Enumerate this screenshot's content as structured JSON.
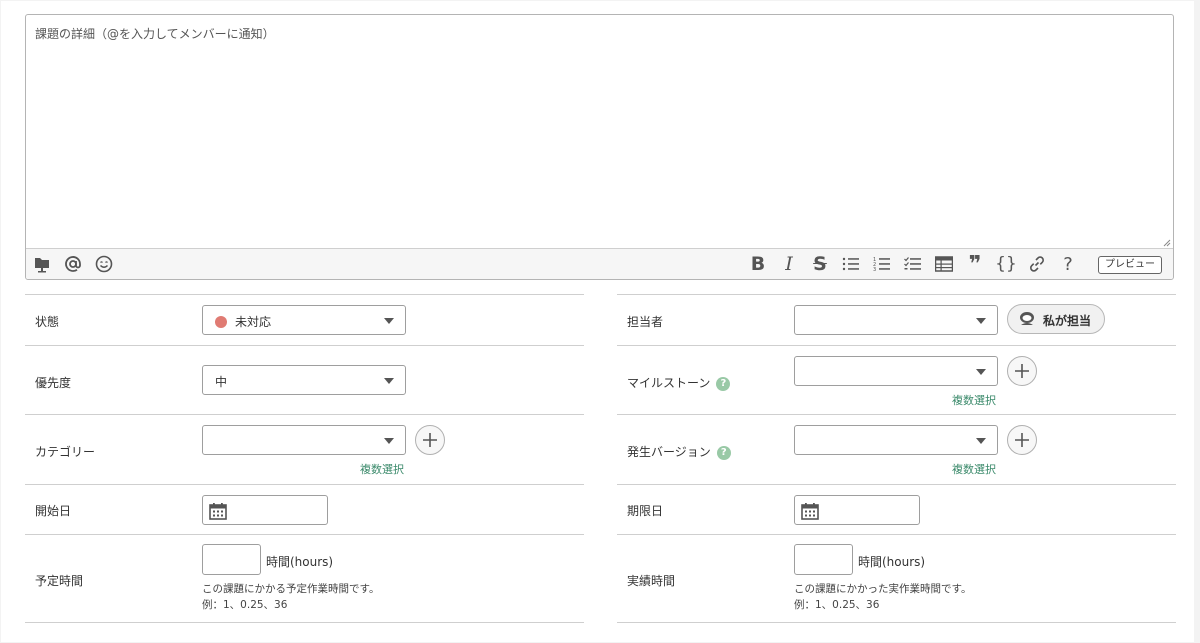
{
  "editor": {
    "placeholder": "課題の詳細（@を入力してメンバーに通知）",
    "value": "",
    "toolbar_left": [
      {
        "icon": "folder-upload-icon"
      },
      {
        "icon": "at-sign-icon"
      },
      {
        "icon": "emoji-icon"
      }
    ],
    "toolbar_right": [
      {
        "icon": "bold-icon",
        "glyph": "B"
      },
      {
        "icon": "italic-icon",
        "glyph": "I"
      },
      {
        "icon": "strikethrough-icon",
        "glyph": "S"
      },
      {
        "icon": "bullet-list-icon"
      },
      {
        "icon": "numbered-list-icon"
      },
      {
        "icon": "checklist-icon"
      },
      {
        "icon": "table-icon"
      },
      {
        "icon": "quote-icon",
        "glyph": "❞"
      },
      {
        "icon": "code-icon",
        "glyph": "{}"
      },
      {
        "icon": "link-icon"
      },
      {
        "icon": "help-icon",
        "glyph": "?"
      }
    ],
    "preview_label": "プレビュー"
  },
  "left": {
    "status": {
      "label": "状態",
      "value": "未対応",
      "status_color": "#e07b73"
    },
    "priority": {
      "label": "優先度",
      "value": "中"
    },
    "category": {
      "label": "カテゴリー",
      "value": "",
      "multi_select": "複数選択"
    },
    "start_date": {
      "label": "開始日",
      "value": ""
    },
    "estimated": {
      "label": "予定時間",
      "unit": "時間(hours)",
      "note1": "この課題にかかる予定作業時間です。",
      "note2": "例：1、0.25、36"
    }
  },
  "right": {
    "assignee": {
      "label": "担当者",
      "value": "",
      "assign_me_label": "私が担当"
    },
    "milestone": {
      "label": "マイルストーン",
      "help": "?",
      "value": "",
      "multi_select": "複数選択"
    },
    "version": {
      "label": "発生バージョン",
      "help": "?",
      "value": "",
      "multi_select": "複数選択"
    },
    "due_date": {
      "label": "期限日",
      "value": ""
    },
    "actual": {
      "label": "実績時間",
      "unit": "時間(hours)",
      "note1": "この課題にかかった実作業時間です。",
      "note2": "例：1、0.25、36"
    }
  },
  "colors": {
    "link_green": "#3b8a6b",
    "help_green": "#99c9a6",
    "border": "#cfcfcf"
  }
}
